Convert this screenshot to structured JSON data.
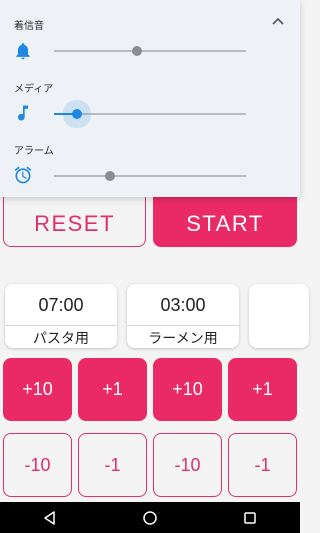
{
  "volume_panel": {
    "ringtone": {
      "label": "着信音",
      "icon": "bell-icon",
      "level": 0.43
    },
    "media": {
      "label": "メディア",
      "icon": "music-note-icon",
      "level": 0.12
    },
    "alarm": {
      "label": "アラーム",
      "icon": "alarm-clock-icon",
      "level": 0.29
    },
    "collapse_icon": "chevron-up-icon"
  },
  "controls": {
    "reset_label": "RESET",
    "start_label": "START"
  },
  "presets": [
    {
      "time": "07:00",
      "name": "パスタ用"
    },
    {
      "time": "03:00",
      "name": "ラーメン用"
    },
    {
      "time": "",
      "name": ""
    }
  ],
  "adjust": {
    "increments": [
      "+10",
      "+1",
      "+10",
      "+1"
    ],
    "decrements": [
      "-10",
      "-1",
      "-10",
      "-1"
    ]
  },
  "nav": [
    "back-icon",
    "home-icon",
    "recents-icon"
  ],
  "colors": {
    "accent": "#ea2a67",
    "slider_active": "#1e88e5",
    "panel_bg": "#eef1f5"
  }
}
